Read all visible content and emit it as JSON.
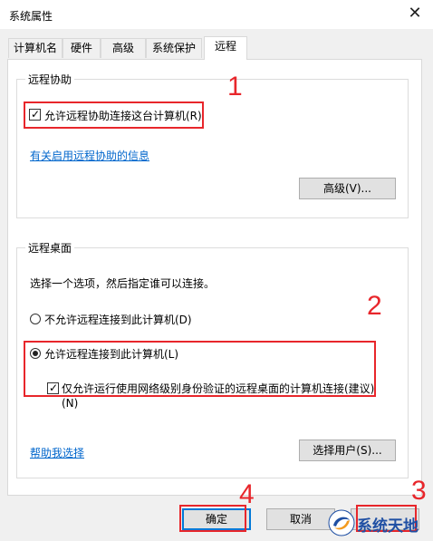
{
  "window": {
    "title": "系统属性",
    "close_glyph": "✕"
  },
  "tabs": [
    {
      "label": "计算机名",
      "active": false
    },
    {
      "label": "硬件",
      "active": false
    },
    {
      "label": "高级",
      "active": false
    },
    {
      "label": "系统保护",
      "active": false
    },
    {
      "label": "远程",
      "active": true
    }
  ],
  "remote_assistance": {
    "group_title": "远程协助",
    "allow_checkbox_label": "允许远程协助连接这台计算机(R)",
    "allow_checked": true,
    "info_link": "有关启用远程协助的信息",
    "advanced_button": "高级(V)..."
  },
  "remote_desktop": {
    "group_title": "远程桌面",
    "instruction": "选择一个选项，然后指定谁可以连接。",
    "deny_radio_label": "不允许远程连接到此计算机(D)",
    "allow_radio_label": "允许远程连接到此计算机(L)",
    "selected_option": "allow",
    "nla_checkbox_label_line1": "仅允许运行使用网络级别身份验证的远程桌面的计算机连接(建议)",
    "nla_checkbox_label_line2": "(N)",
    "nla_checked": true,
    "help_link": "帮助我选择",
    "select_users_button": "选择用户(S)..."
  },
  "footer": {
    "ok_button": "确定",
    "cancel_button": "取消",
    "apply_button": ""
  },
  "annotations": {
    "numbers": [
      "1",
      "2",
      "3",
      "4"
    ],
    "color": "#e8262b"
  },
  "watermark": {
    "text": "系统天地",
    "icon": "swirl-logo-icon"
  }
}
